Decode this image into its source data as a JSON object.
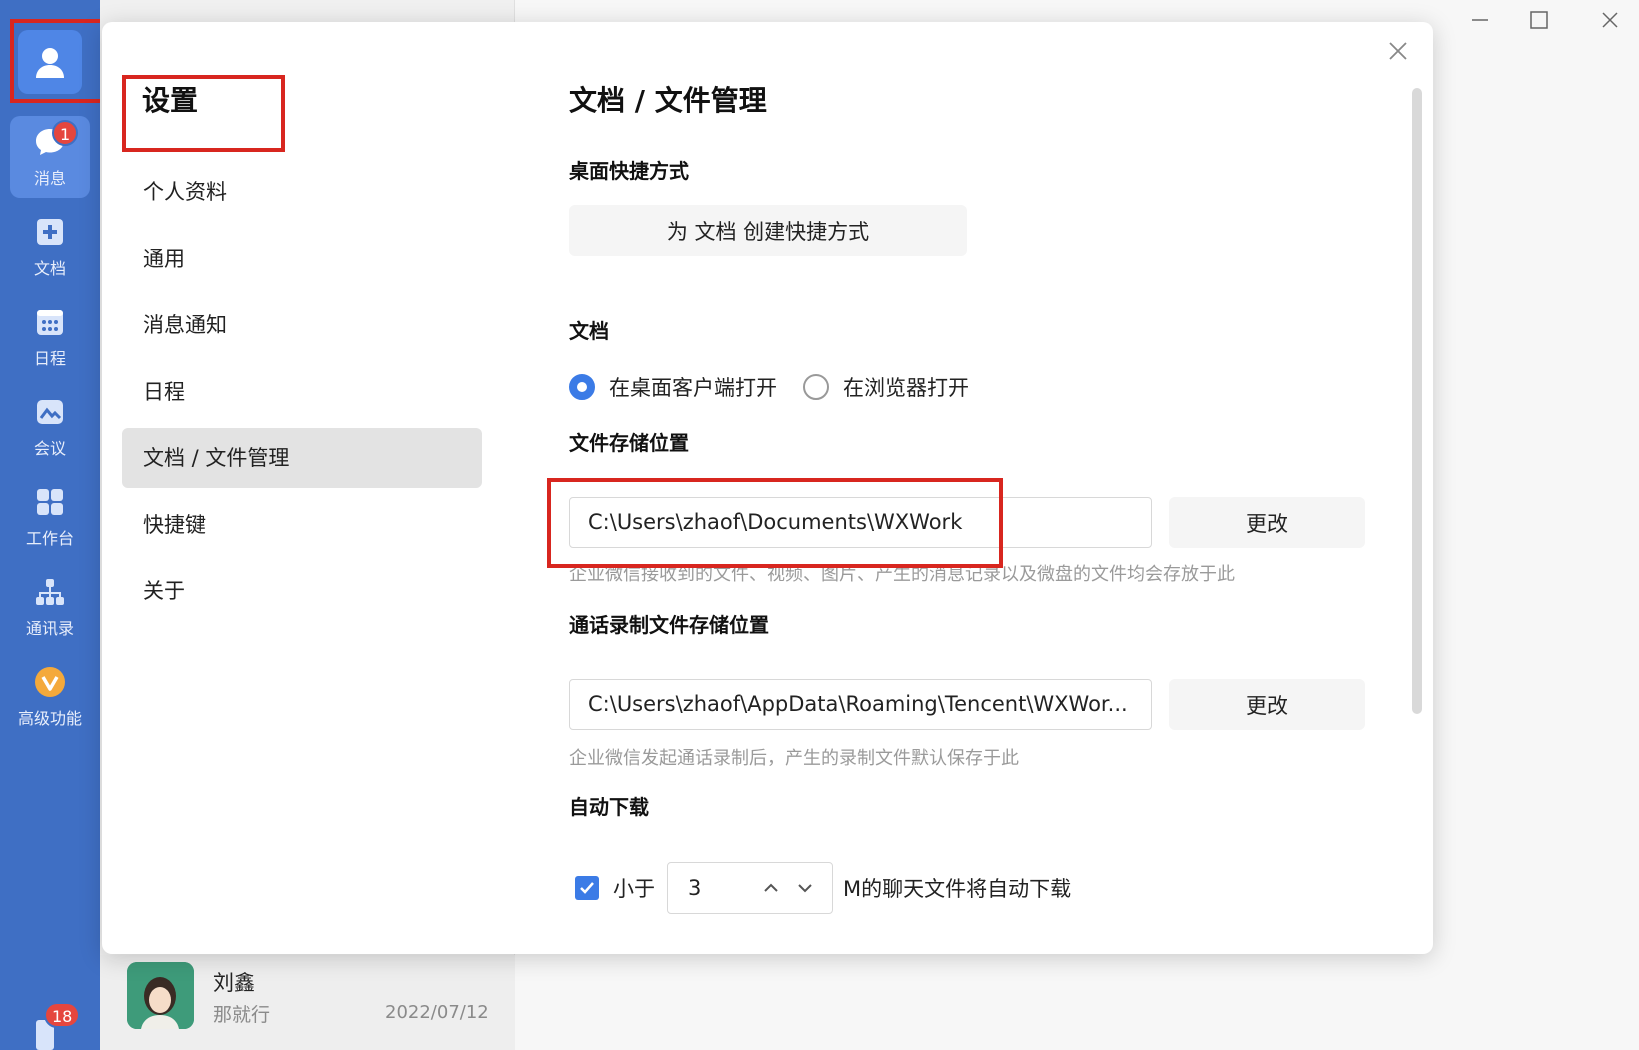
{
  "rail": {
    "items": [
      {
        "label": "消息",
        "icon": "chat-bubble-icon",
        "badge": "1"
      },
      {
        "label": "文档",
        "icon": "document-icon"
      },
      {
        "label": "日程",
        "icon": "calendar-icon"
      },
      {
        "label": "会议",
        "icon": "meeting-icon"
      },
      {
        "label": "工作台",
        "icon": "workbench-icon"
      },
      {
        "label": "通讯录",
        "icon": "contacts-icon"
      },
      {
        "label": "高级功能",
        "icon": "premium-icon"
      }
    ],
    "bottom_badge": "18"
  },
  "chat": {
    "name": "刘鑫",
    "message": "那就行",
    "date": "2022/07/12"
  },
  "settings": {
    "title": "设置",
    "menu": [
      "个人资料",
      "通用",
      "消息通知",
      "日程",
      "文档 / 文件管理",
      "快捷键",
      "关于"
    ],
    "active_index": 4
  },
  "content": {
    "title": "文档 / 文件管理",
    "shortcut": {
      "heading": "桌面快捷方式",
      "button": "为 文档 创建快捷方式"
    },
    "doc": {
      "heading": "文档",
      "option_desktop": "在桌面客户端打开",
      "option_browser": "在浏览器打开",
      "selected": "在桌面客户端打开"
    },
    "storage": {
      "heading": "文件存储位置",
      "path": "C:\\Users\\zhaof\\Documents\\WXWork",
      "change": "更改",
      "hint": "企业微信接收到的文件、视频、图片、产生的消息记录以及微盘的文件均会存放于此"
    },
    "call_storage": {
      "heading": "通话录制文件存储位置",
      "path": "C:\\Users\\zhaof\\AppData\\Roaming\\Tencent\\WXWor...",
      "change": "更改",
      "hint": "企业微信发起通话录制后，产生的录制文件默认保存于此"
    },
    "auto_download": {
      "heading": "自动下载",
      "checked": true,
      "prefix": "小于",
      "value": "3",
      "suffix": "M的聊天文件将自动下载"
    }
  },
  "colors": {
    "rail": "#3f6fc4",
    "accent": "#3b7be6",
    "highlight": "#d8261f",
    "badge": "#e5463e"
  }
}
